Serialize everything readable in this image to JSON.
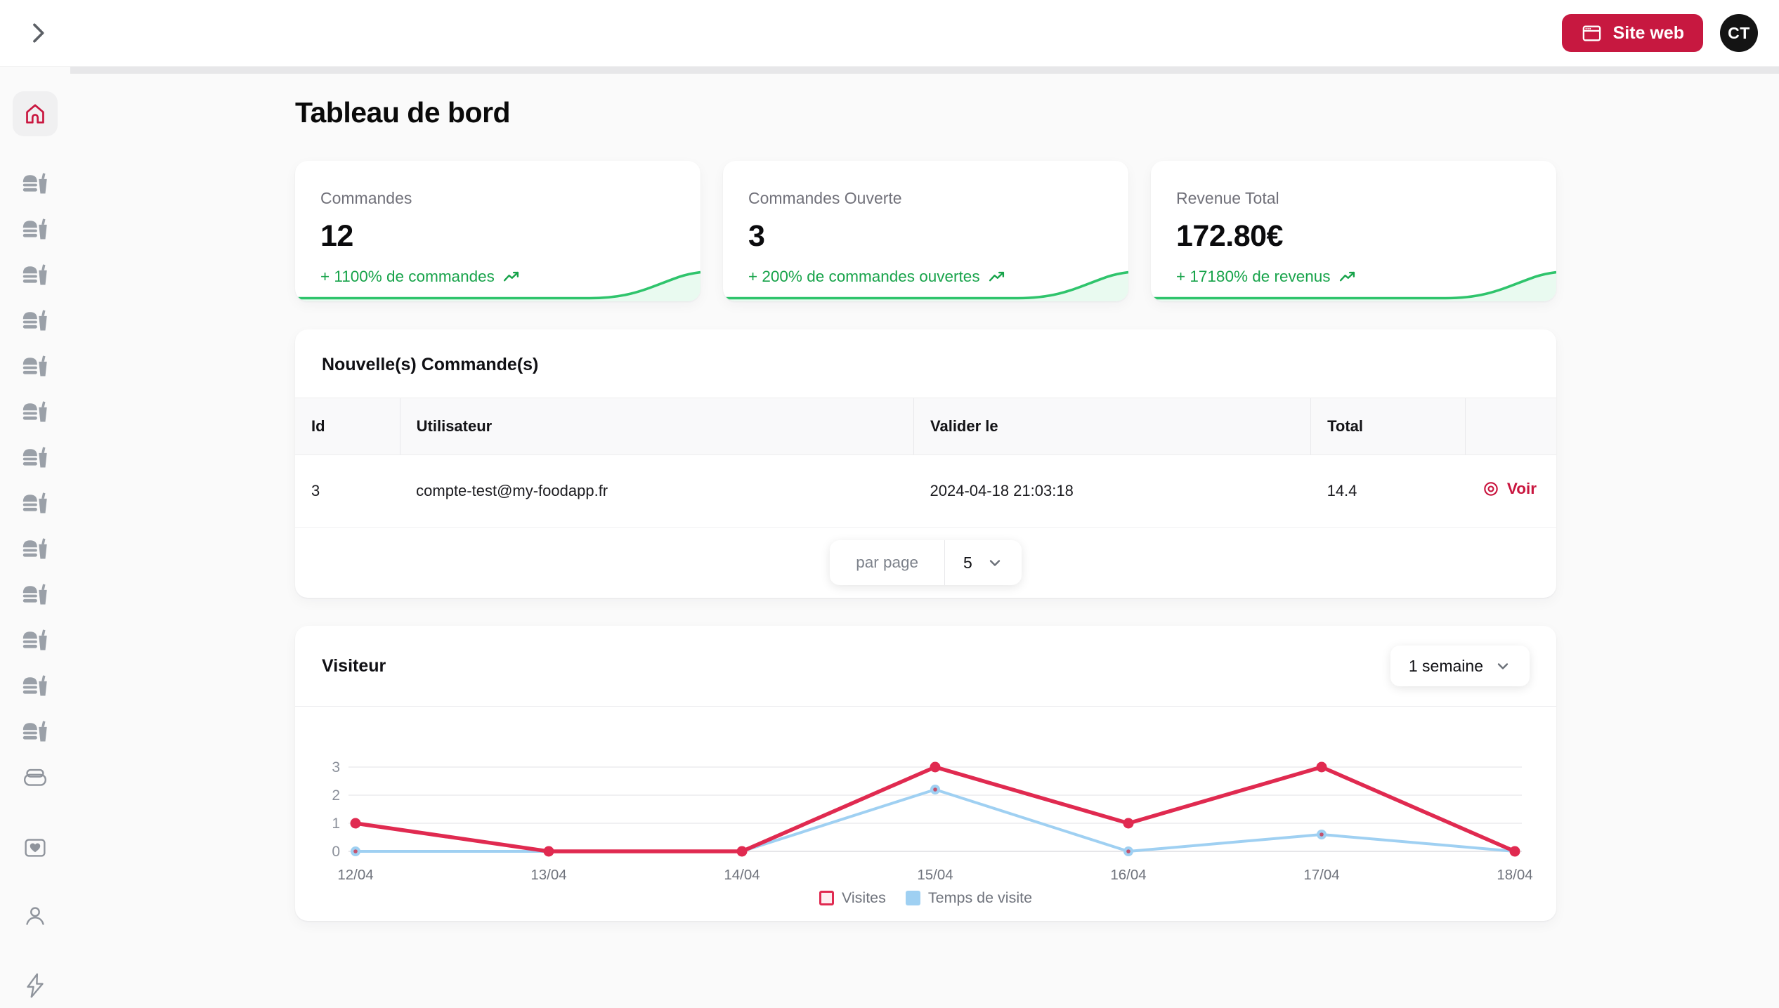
{
  "topbar": {
    "site_web_button": "Site web",
    "avatar_initials": "CT"
  },
  "page_title": "Tableau de bord",
  "colors": {
    "accent": "#c9163f",
    "button_red": "#c71840",
    "positive_green": "#17a34a",
    "avatar_bg": "#141414",
    "visites_line": "#e02a50",
    "temps_line": "#9fd0f2"
  },
  "sidebar": {
    "items": [
      {
        "icon": "home",
        "active": true
      },
      {
        "icon": "restaurant"
      },
      {
        "icon": "restaurant"
      },
      {
        "icon": "restaurant"
      },
      {
        "icon": "restaurant"
      },
      {
        "icon": "restaurant"
      },
      {
        "icon": "restaurant"
      },
      {
        "icon": "restaurant"
      },
      {
        "icon": "restaurant"
      },
      {
        "icon": "restaurant"
      },
      {
        "icon": "restaurant"
      },
      {
        "icon": "restaurant"
      },
      {
        "icon": "restaurant"
      },
      {
        "icon": "restaurant"
      },
      {
        "icon": "lunchbox"
      },
      {
        "icon": "card-heart",
        "spaced": true
      },
      {
        "icon": "user",
        "spaced": true
      },
      {
        "icon": "lightning",
        "spaced": true
      }
    ]
  },
  "stats": [
    {
      "label": "Commandes",
      "value": "12",
      "delta": "+ 1100% de commandes"
    },
    {
      "label": "Commandes Ouverte",
      "value": "3",
      "delta": "+ 200% de commandes ouvertes"
    },
    {
      "label": "Revenue Total",
      "value": "172.80€",
      "delta": "+ 17180% de revenus"
    }
  ],
  "orders": {
    "title": "Nouvelle(s) Commande(s)",
    "columns": [
      "Id",
      "Utilisateur",
      "Valider le",
      "Total",
      ""
    ],
    "rows": [
      {
        "id": "3",
        "user": "compte-test@my-foodapp.fr",
        "validated_at": "2024-04-18 21:03:18",
        "total": "14.4",
        "action": "Voir"
      }
    ],
    "pagination": {
      "label": "par page",
      "per_page": "5"
    }
  },
  "visitors": {
    "title": "Visiteur",
    "range": "1 semaine"
  },
  "chart_data": {
    "type": "line",
    "x": [
      "12/04",
      "13/04",
      "14/04",
      "15/04",
      "16/04",
      "17/04",
      "18/04"
    ],
    "series": [
      {
        "name": "Visites",
        "values": [
          1,
          0,
          0,
          3,
          1,
          3,
          0
        ],
        "color": "#e02a50"
      },
      {
        "name": "Temps de visite",
        "values": [
          0,
          0,
          0,
          2.2,
          0,
          0.6,
          0
        ],
        "color": "#9fd0f2"
      }
    ],
    "yticks": [
      0,
      1,
      2,
      3
    ],
    "ylim": [
      0,
      3.3
    ],
    "grid": true,
    "legend_position": "bottom"
  }
}
